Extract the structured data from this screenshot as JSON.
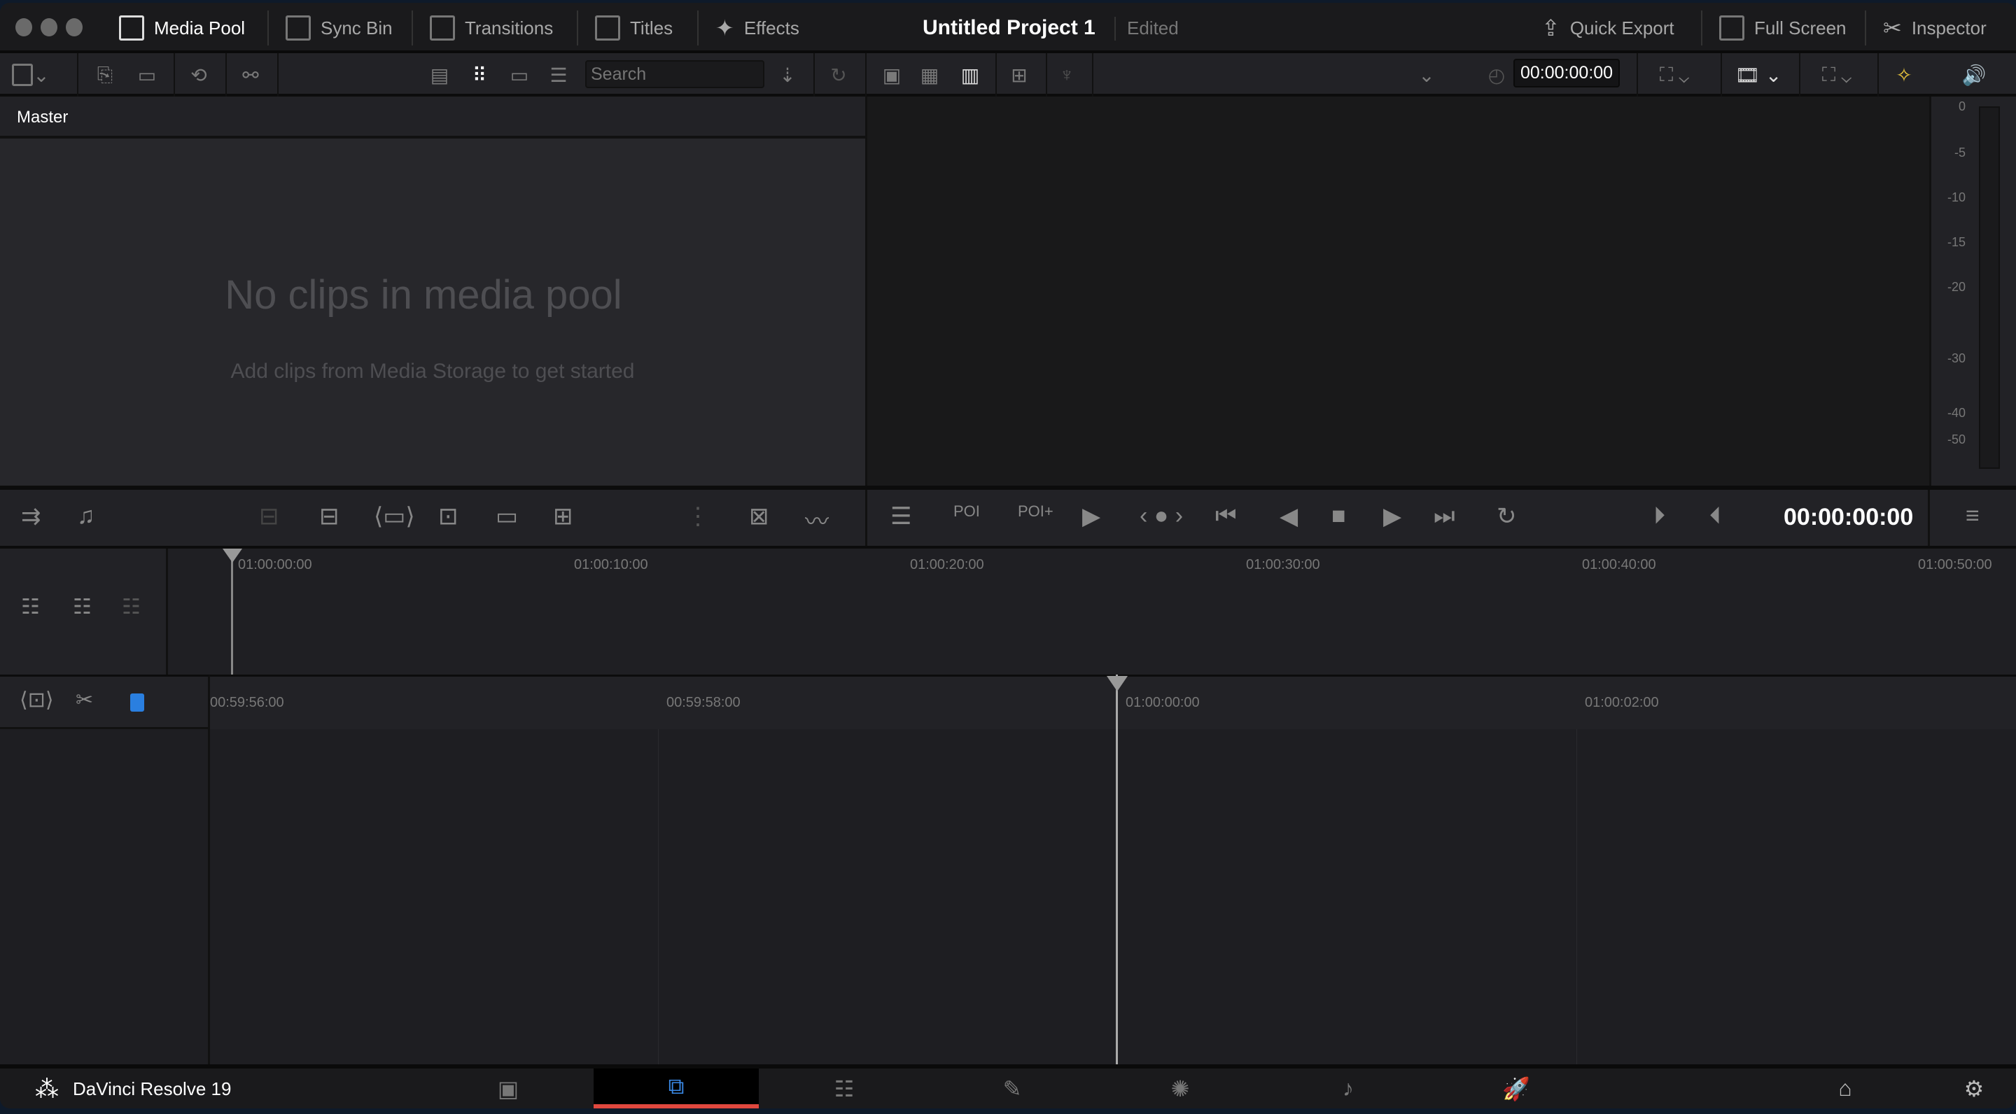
{
  "titlebar": {
    "tabs": [
      {
        "label": "Media Pool",
        "icon": "media-pool-icon",
        "active": true
      },
      {
        "label": "Sync Bin",
        "icon": "sync-bin-icon"
      },
      {
        "label": "Transitions",
        "icon": "transitions-icon"
      },
      {
        "label": "Titles",
        "icon": "titles-icon"
      },
      {
        "label": "Effects",
        "icon": "effects-icon"
      }
    ],
    "project": "Untitled Project 1",
    "status": "Edited",
    "right": [
      {
        "label": "Quick Export",
        "icon": "export-icon"
      },
      {
        "label": "Full Screen",
        "icon": "fullscreen-icon"
      },
      {
        "label": "Inspector",
        "icon": "inspector-icon"
      }
    ]
  },
  "media_pool": {
    "search_placeholder": "Search",
    "bin": "Master",
    "empty_title": "No clips in media pool",
    "empty_sub": "Add clips from Media Storage to get started"
  },
  "viewer": {
    "timecode": "00:00:00:00",
    "transport_timecode": "00:00:00:00"
  },
  "meter": {
    "labels": [
      "0",
      "-5",
      "-10",
      "-15",
      "-20",
      "-30",
      "-40",
      "-50"
    ]
  },
  "timeline": {
    "upper_ticks": [
      "01:00:00:00",
      "01:00:10:00",
      "01:00:20:00",
      "01:00:30:00",
      "01:00:40:00",
      "01:00:50:00"
    ],
    "lower_ticks": [
      "00:59:56:00",
      "00:59:58:00",
      "01:00:00:00",
      "01:00:02:00"
    ]
  },
  "bottom": {
    "app": "DaVinci Resolve 19",
    "pages": [
      "media",
      "cut",
      "edit",
      "fusion",
      "color",
      "fairlight",
      "deliver"
    ],
    "active_page": "cut",
    "accent": "#e0483e"
  }
}
